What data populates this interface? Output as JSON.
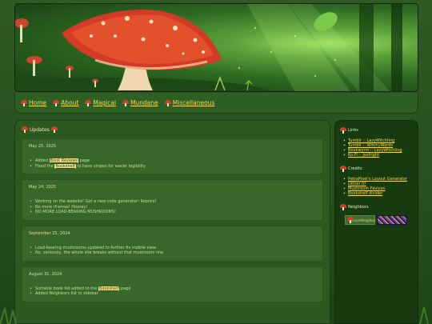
{
  "nav": {
    "items": [
      {
        "label": "Home"
      },
      {
        "label": "About"
      },
      {
        "label": "Magical"
      },
      {
        "label": "Mundane"
      },
      {
        "label": "Miscellaneous"
      }
    ]
  },
  "main": {
    "title": "Updates",
    "updates": [
      {
        "date": "May 25, 2025",
        "lines": [
          {
            "pre": "Added ",
            "link": "Book Reviews",
            "post": " page"
          },
          {
            "pre": "Fixed the ",
            "link": "Bookshelf",
            "post": " to have stripes for easier legibility"
          }
        ]
      },
      {
        "date": "May 24, 2025",
        "lines": [
          {
            "pre": "Working on the website! Got a new code generator! Rejoice!",
            "link": "",
            "post": ""
          },
          {
            "pre": "No more iframes! Hooray!",
            "link": "",
            "post": ""
          },
          {
            "pre": "NO MORE LOAD-BEARING MUSHROOMS!",
            "link": "",
            "post": ""
          }
        ]
      },
      {
        "date": "September 25, 2024",
        "lines": [
          {
            "pre": "Load-bearing mushrooms updated to further fix mobile view",
            "link": "",
            "post": ""
          },
          {
            "pre": "No, seriously, the whole site breaks without that mushroom line",
            "link": "",
            "post": ""
          }
        ]
      },
      {
        "date": "August 31, 2024",
        "lines": [
          {
            "pre": "Sortable book list added to the ",
            "link": "Bookshelf",
            "post": " page"
          },
          {
            "pre": "Added Neighbors list to sidebar",
            "link": "",
            "post": ""
          }
        ]
      }
    ]
  },
  "sidebar": {
    "links_title": "Links",
    "links": [
      "Tumblr :: LazyWitchling",
      "Tumblr :: WitchyWords",
      "Bookwyrm :: LazyWitchling",
      "Ko-Fi :: Jesfright"
    ],
    "credits_title": "Credits",
    "credits": [
      "PetraPixel's Layout Generator",
      "Dither It!",
      "Mushroom Favicon",
      "Bookshelf divider"
    ],
    "neighbors_title": "Neighbors",
    "neighbor_badge": "ShroomNeighbor"
  },
  "colors": {
    "link": "#f1dd4a",
    "panel": "#2b5a20",
    "card": "#37672b",
    "sidebar": "#173a11",
    "mushroom_cap": "#d8402a"
  }
}
